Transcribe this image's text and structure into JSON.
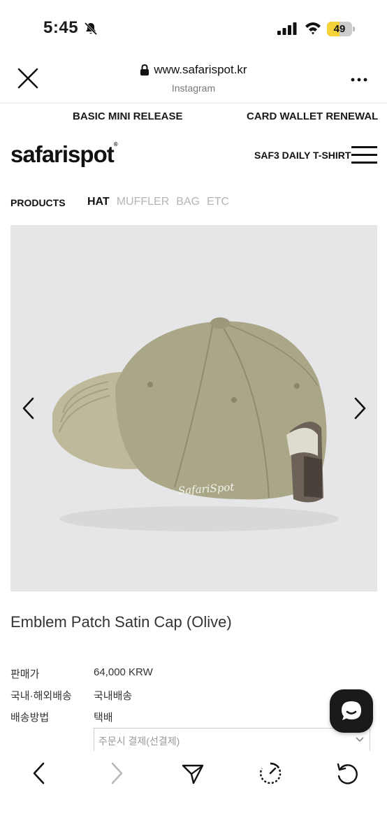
{
  "status_bar": {
    "time": "5:45",
    "battery_level": "49",
    "battery_fraction": 0.49,
    "icons": [
      "bell-slash-icon",
      "signal-icon",
      "wifi-icon",
      "battery-icon"
    ]
  },
  "browser": {
    "url": "www.safarispot.kr",
    "source": "Instagram",
    "icons": [
      "close-icon",
      "lock-icon",
      "more-icon"
    ]
  },
  "site": {
    "promo_left": "BASIC MINI RELEASE",
    "promo_right": "CARD WALLET RENEWAL",
    "logo": "safarispot",
    "tshirt_link": "SAF3 DAILY T-SHIRT",
    "categories_label": "PRODUCTS",
    "categories": [
      {
        "label": "HAT",
        "active": true
      },
      {
        "label": "MUFFLER",
        "active": false
      },
      {
        "label": "BAG",
        "active": false
      },
      {
        "label": "ETC",
        "active": false
      }
    ],
    "cap_brand_text": "SafariSpot"
  },
  "product": {
    "title": "Emblem Patch Satin Cap (Olive)",
    "info": [
      {
        "label": "판매가",
        "value": "64,000 KRW"
      },
      {
        "label": "국내·해외배송",
        "value": "국내배송"
      },
      {
        "label": "배송방법",
        "value": "택배"
      }
    ],
    "shipping_select": "주문시 결제(선결제)"
  },
  "colors": {
    "accent": "#111111",
    "muted": "#b4b4b4",
    "image_bg": "#e6e6e8",
    "cap_olive": "#a9a686",
    "battery": "#f4d23a"
  },
  "toolbar": {
    "icons": [
      "back-icon",
      "forward-icon",
      "share-icon",
      "speed-icon",
      "reload-icon"
    ]
  }
}
